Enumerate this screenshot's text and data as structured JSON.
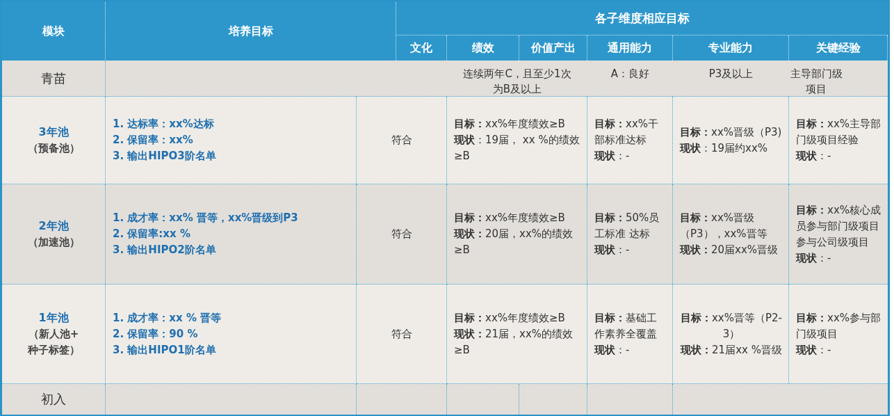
{
  "header": {
    "module": "模块",
    "goal": "培养目标",
    "dimensions": "各子维度相应目标",
    "sub_columns": [
      "文化",
      "绩效",
      "价值产出",
      "通用能力",
      "专业能力",
      "关键经验"
    ]
  },
  "intro_row": {
    "module": "青苗",
    "performance": [
      "连续两年C，且至少1次",
      "为B及以上"
    ],
    "general": [
      "A：良好"
    ],
    "professional": [
      "P3及以上"
    ],
    "experience": [
      "主导部门级",
      "项目"
    ]
  },
  "pools": [
    {
      "name": "3年池",
      "subtitle": [
        "（预备池）"
      ],
      "goals": [
        "1. 达标率：xx%达标",
        "2. 保留率：xx%",
        "3. 输出HIPO3阶名单"
      ],
      "culture": "符合",
      "performance": [
        "**目标：**xx%年度绩效≥B",
        "**现状**：19届， xx %的绩效≥B"
      ],
      "general": [
        "**目标：**xx%干部标准达标",
        "**现状**：-"
      ],
      "professional": {
        "centered": false,
        "paragraphs": [
          "**目标：**xx%晋级（P3)",
          "**现状**：19届约xx%"
        ]
      },
      "experience": [
        "**目标：**xx%主导部门级项目经验",
        "**现状**：-"
      ]
    },
    {
      "name": "2年池",
      "subtitle": [
        "（加速池）"
      ],
      "goals": [
        "1. 成才率：xx% 晋等，xx%晋级到P3",
        "2. 保留率:xx %",
        "3. 输出HIPO2阶名单"
      ],
      "culture": "符合",
      "performance": [
        "**目标：**xx%年度绩效≥B",
        "**现状：**20届，xx%的绩效≥B"
      ],
      "general": [
        "**目标：**50%员工标准 达标",
        "**现状**：-"
      ],
      "professional": {
        "centered": false,
        "paragraphs": [
          "**目标：**xx%晋级（P3），xx%晋等",
          "**现状：**20届xx%晋级"
        ]
      },
      "experience": [
        "**目标：**xx%核心成员参与部门级项目",
        "参与公司级项目",
        "**现状**：-"
      ]
    },
    {
      "name": "1年池",
      "subtitle": [
        "（新人池+",
        "种子标签）"
      ],
      "goals": [
        "1. 成才率：xx % 晋等",
        "2. 保留率：90 %",
        "3. 输出HIPO1阶名单"
      ],
      "culture": "符合",
      "performance": [
        "**目标：**xx%年度绩效≥B",
        "**现状：**21届，xx%的绩效≥B"
      ],
      "general": [
        "**目标：**基础工作素养全覆盖",
        "**现状**：-"
      ],
      "professional": {
        "centered": true,
        "paragraphs": [
          "**目标：**xx%晋等（P2-3）",
          "**现状：**21届xx %晋级"
        ]
      },
      "experience": [
        "**目标：**xx%参与部门级项目",
        "**现状**：-"
      ]
    }
  ],
  "final_row": {
    "module": "初入"
  }
}
